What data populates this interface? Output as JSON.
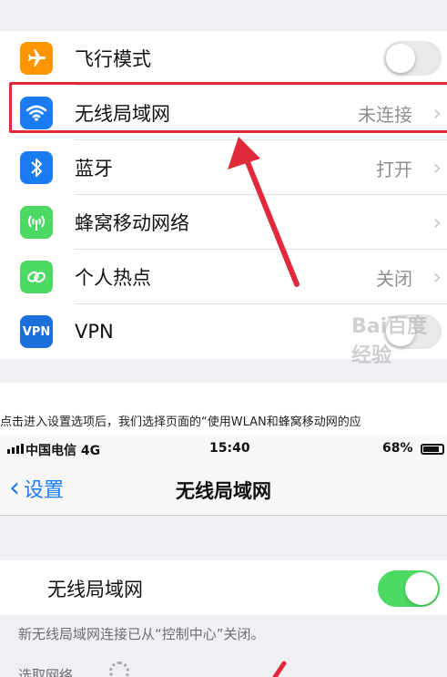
{
  "screenshot1": {
    "items": [
      {
        "label": "飞行模式",
        "value": "",
        "icon": "airplane-icon",
        "color": "#ff9500",
        "control": "toggle-off"
      },
      {
        "label": "无线局域网",
        "value": "未连接",
        "icon": "wifi-icon",
        "color": "#1a7cf0",
        "control": "chevron"
      },
      {
        "label": "蓝牙",
        "value": "打开",
        "icon": "bluetooth-icon",
        "color": "#1a7cf0",
        "control": "chevron"
      },
      {
        "label": "蜂窝移动网络",
        "value": "",
        "icon": "cellular-icon",
        "color": "#4cd964",
        "control": "chevron"
      },
      {
        "label": "个人热点",
        "value": "关闭",
        "icon": "hotspot-icon",
        "color": "#4cd964",
        "control": "chevron"
      },
      {
        "label": "VPN",
        "value": "",
        "icon": "vpn-icon",
        "color": "#1a6fd8",
        "control": "toggle-off"
      }
    ],
    "vpn_icon_text": "VPN",
    "watermark": "Bai百度经验",
    "highlight_color": "#e0293a"
  },
  "caption": "点击进入设置选项后，我们选择页面的“使用WLAN和蜂窝移动网的应",
  "screenshot2": {
    "status": {
      "carrier": "中国电信  4G",
      "time": "15:40",
      "battery": "68%"
    },
    "nav": {
      "back_label": "设置",
      "title": "无线局域网"
    },
    "wifi_row_label": "无线局域网",
    "note": "新无线局域网连接已从“控制中心”关闭。",
    "choose_network": "选取网络...",
    "toggle_color": "#4cd964"
  }
}
